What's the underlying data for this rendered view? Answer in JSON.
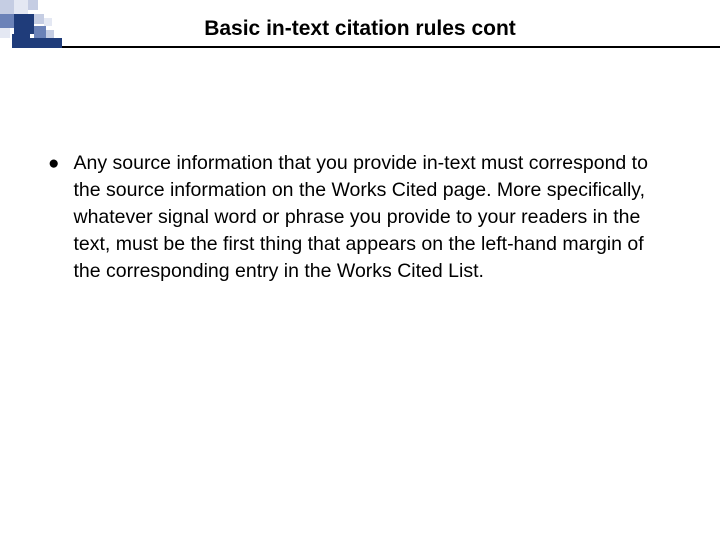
{
  "title": "Basic in-text citation rules cont",
  "bullet": "●",
  "body": "Any source information that you provide in-text must correspond to the source information on the Works Cited page. More specifically, whatever signal word or phrase you provide to your readers in the text, must be the first thing that appears on the left-hand margin of the corresponding entry in the Works Cited List.",
  "colors": {
    "dark": "#1f3c7a",
    "mid": "#6b82b8",
    "light": "#c5cde3",
    "pale": "#e4e8f3"
  }
}
